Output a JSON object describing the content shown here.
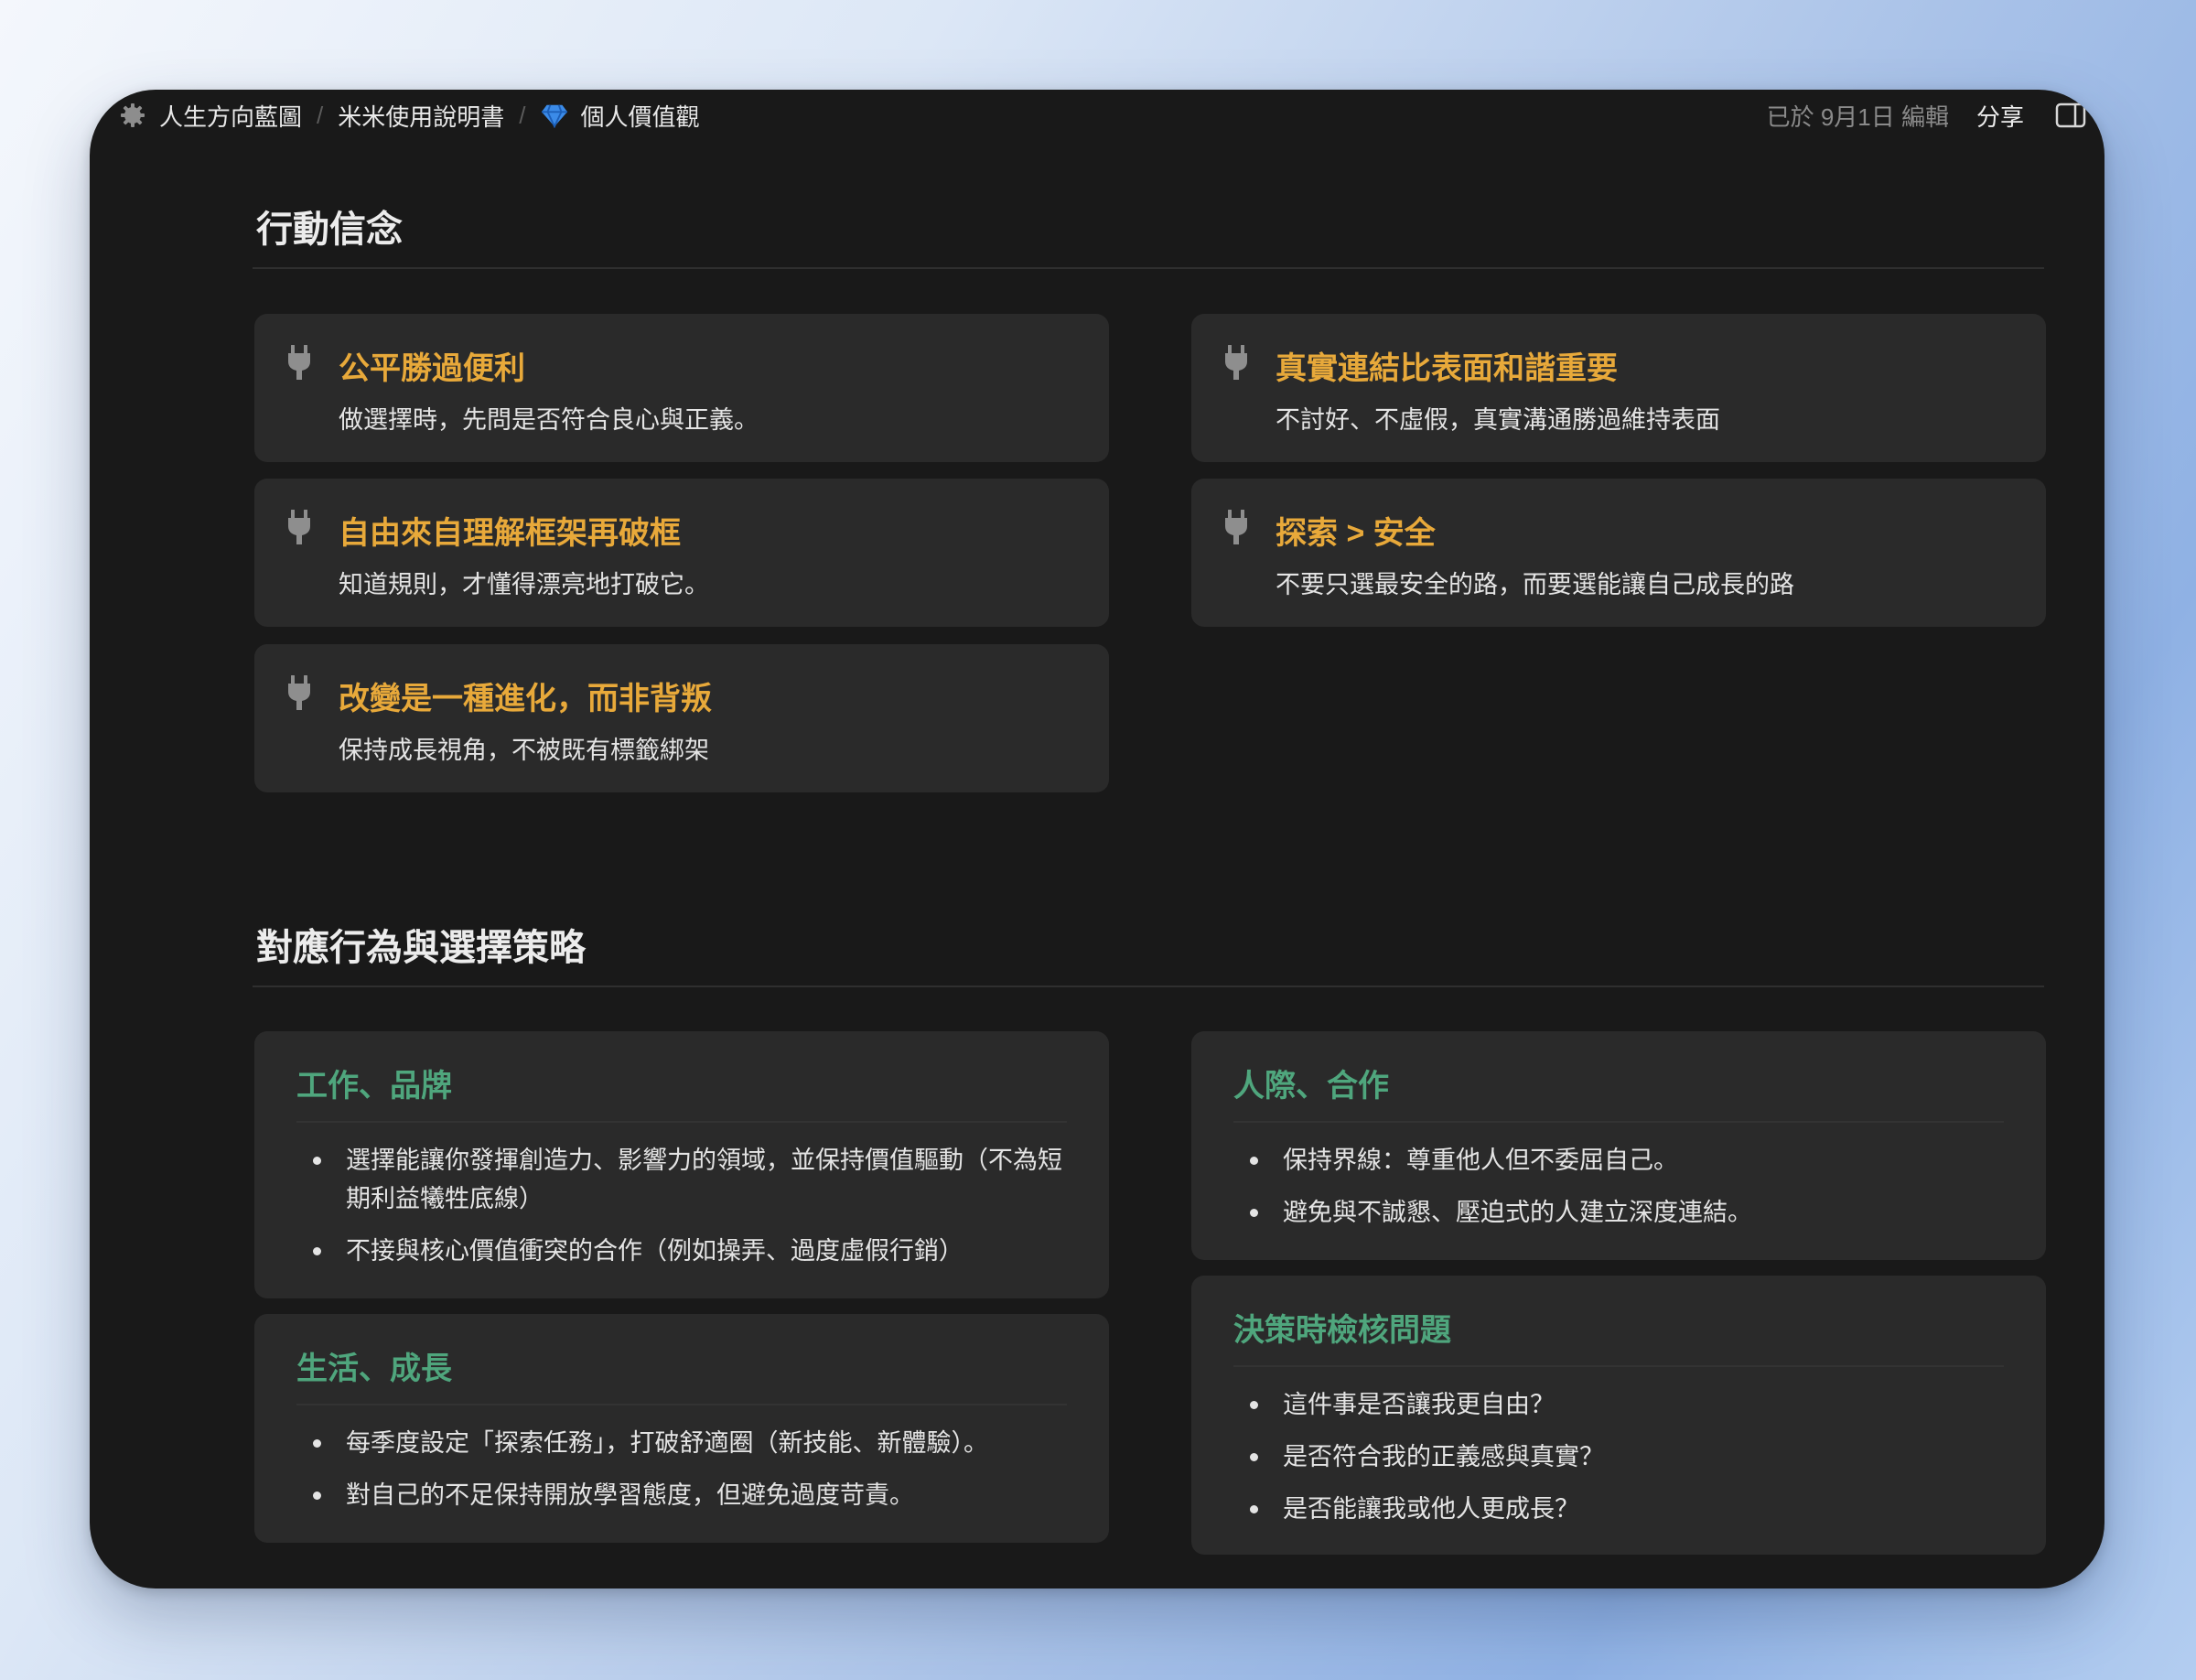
{
  "breadcrumb": {
    "items": [
      {
        "label": "人生方向藍圖",
        "icon": "gear-icon"
      },
      {
        "label": "米米使用說明書",
        "icon": ""
      },
      {
        "label": "個人價值觀",
        "icon": "gem-icon"
      }
    ],
    "separator": "/"
  },
  "topbar": {
    "edited": "已於 9月1日 編輯",
    "share_label": "分享",
    "panel_icon": "sidebar-panel-icon"
  },
  "sections": {
    "beliefs_title": "行動信念",
    "strategies_title": "對應行為與選擇策略"
  },
  "beliefs": [
    {
      "title": "公平勝過便利",
      "desc": "做選擇時，先問是否符合良心與正義。"
    },
    {
      "title": "真實連結比表面和諧重要",
      "desc": "不討好、不虛假，真實溝通勝過維持表面"
    },
    {
      "title": "自由來自理解框架再破框",
      "desc": "知道規則，才懂得漂亮地打破它。"
    },
    {
      "title": "探索 > 安全",
      "desc": "不要只選最安全的路，而要選能讓自己成長的路"
    },
    {
      "title": "改變是一種進化，而非背叛",
      "desc": "保持成長視角，不被既有標籤綁架"
    }
  ],
  "strategies": {
    "work": {
      "title": "工作、品牌",
      "items": [
        "選擇能讓你發揮創造力、影響力的領域，並保持價值驅動（不為短期利益犧牲底線）",
        "不接與核心價值衝突的合作（例如操弄、過度虛假行銷）"
      ]
    },
    "life": {
      "title": "生活、成長",
      "items": [
        "每季度設定「探索任務」，打破舒適圈（新技能、新體驗）。",
        "對自己的不足保持開放學習態度，但避免過度苛責。"
      ]
    },
    "relations": {
      "title": "人際、合作",
      "items": [
        "保持界線：尊重他人但不委屈自己。",
        "避免與不誠懇、壓迫式的人建立深度連結。"
      ]
    },
    "decision": {
      "title": "決策時檢核問題",
      "items": [
        "這件事是否讓我更自由？",
        "是否符合我的正義感與真實？",
        "是否能讓我或他人更成長？"
      ]
    }
  },
  "colors": {
    "belief_title": "#e8a93a",
    "strategy_title": "#4fa67d",
    "card_bg": "#2a2a2a",
    "window_bg": "#191919"
  }
}
